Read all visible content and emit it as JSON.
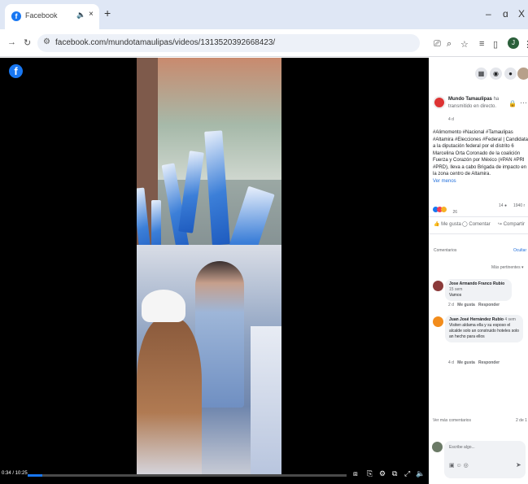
{
  "browser": {
    "tab_title": "Facebook",
    "tab_mute_icon": "speaker-icon",
    "tab_close": "×",
    "new_tab": "+",
    "url": "facebook.com/mundotamaulipas/videos/1313520392668423/",
    "window_minimize": "–",
    "window_restore": "ɑ",
    "window_close": "X",
    "profile_initial": "J"
  },
  "video": {
    "time": "0:34 / 10:25",
    "progress_fraction": 0.045
  },
  "post": {
    "page_name": "Mundo Tamaulipas",
    "action": "ha transmitido en directo.",
    "timestamp": "4 d",
    "text": "#Alimomento #Nacional #Tamaulipas #Altamira #Elecciones #Federal | Candidata a la diputación federal por el distrito 6 Marcelina Orta Coronado de la coalición Fuerza y Corazón por México (#PAN #PRI #PRD), lleva a cabo Brigada de impacto en la zona centro de Altamira.",
    "see_more": "Ver menos",
    "reaction_count": "26",
    "comment_count": "14",
    "view_count": "1940 r",
    "like_label": "Me gusta",
    "comment_label": "Comentar",
    "share_label": "Compartir"
  },
  "comments_section": {
    "title": "Comentarios",
    "hide_label": "Ocultar",
    "sort_label": "Más pertinentes ▾",
    "view_more": "Ver más comentarios",
    "count_label": "2 de 1",
    "write_placeholder": "Escribe algo..."
  },
  "comments": [
    {
      "author": "Jose Armando Franco Rubio",
      "age_badge": "15 sem",
      "text": "Vamos",
      "time": "2 d",
      "like": "Me gusta",
      "reply": "Responder"
    },
    {
      "author": "Juan José Hernández Rubio",
      "age_badge": "4 sem",
      "text": "Visiten aldama ella y su esposo el alcalde solo an construido hoteles solo an hecho para ellos",
      "time": "4 d",
      "like": "Me gusta",
      "reply": "Responder"
    }
  ],
  "colors": {
    "fb_blue": "#1877f2",
    "link_blue": "#216fdb",
    "panel_gray": "#f0f2f5"
  }
}
